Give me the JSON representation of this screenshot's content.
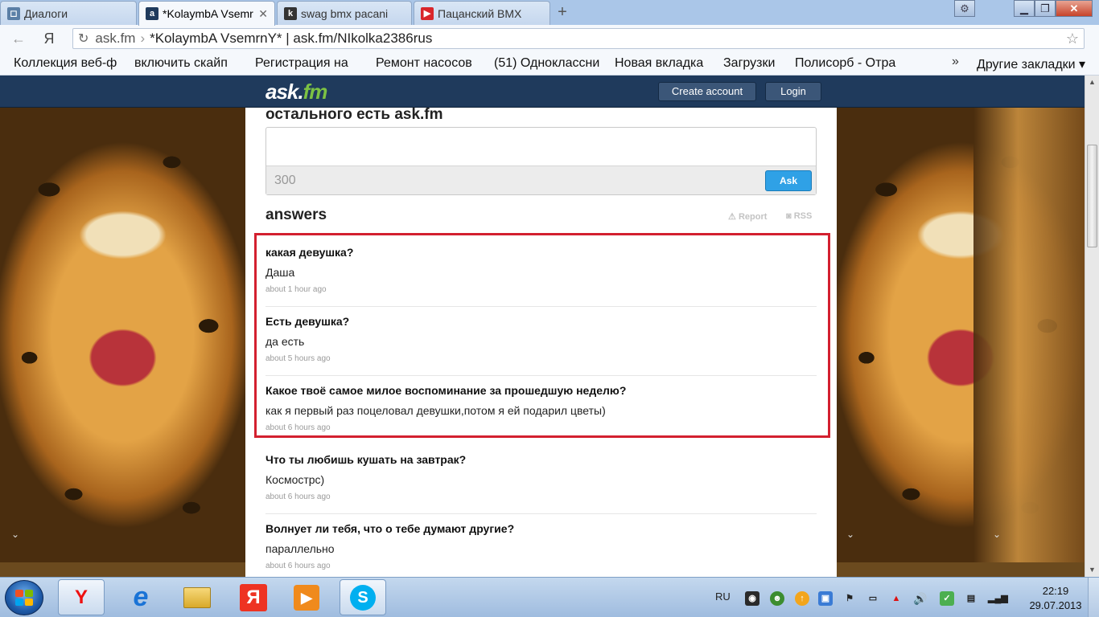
{
  "browser": {
    "tabs": [
      {
        "label": "Диалоги",
        "favicon": "vk-icon"
      },
      {
        "label": "*KolaymbA Vsemr",
        "favicon": "askfm-icon",
        "active": true
      },
      {
        "label": "swag bmx pacani",
        "favicon": "bmx-icon"
      },
      {
        "label": "Пацанский BMX",
        "favicon": "youtube-icon"
      }
    ],
    "new_tab": "+",
    "address": {
      "host": "ask.fm",
      "separator": "›",
      "title": "*KolaymbA VsemrnY* | ask.fm/NIkolka2386rus"
    },
    "nav": {
      "back": "←",
      "yandex": "Я",
      "reload": "↻",
      "star": "☆"
    },
    "bookmarks": [
      "Коллекция веб-ф",
      "включить скайп",
      "Регистрация на",
      "Ремонт насосов",
      "(51) Одноклассни",
      "Новая вкладка",
      "Загрузки",
      "Полисорб - Отра"
    ],
    "bookmarks_more": "»",
    "other_bookmarks": "Другие закладки"
  },
  "askfm": {
    "logo_main": "ask.",
    "logo_fm": "fm",
    "create_account": "Create account",
    "login": "Login",
    "intro_text": "остального есть ask.fm",
    "counter": "300",
    "ask_button": "Ask",
    "answers_title": "answers",
    "report": "Report",
    "rss": "RSS",
    "answers": [
      {
        "question": "какая девушка?",
        "answer": "Даша",
        "time": "about 1 hour ago"
      },
      {
        "question": "Есть девушка?",
        "answer": "да есть",
        "time": "about 5 hours ago"
      },
      {
        "question": "Какое твоё самое милое воспоминание за прошедшую неделю?",
        "answer": "как я первый раз поцеловал девушки,потом я ей подарил цветы)",
        "time": "about 6 hours ago"
      },
      {
        "question": "Что ты любишь кушать на завтрак?",
        "answer": "Космострс)",
        "time": "about 6 hours ago"
      },
      {
        "question": "Волнует ли тебя, что о тебе думают другие?",
        "answer": "параллельно",
        "time": "about 6 hours ago"
      }
    ]
  },
  "taskbar": {
    "apps": [
      {
        "name": "yandex-browser",
        "label": "Y"
      },
      {
        "name": "internet-explorer",
        "label": "e"
      },
      {
        "name": "file-explorer",
        "label": ""
      },
      {
        "name": "yandex",
        "label": "Я"
      },
      {
        "name": "media-player",
        "label": "▶"
      },
      {
        "name": "skype",
        "label": "S"
      }
    ],
    "language": "RU",
    "time": "22:19",
    "date": "29.07.2013"
  },
  "colors": {
    "askfm_header": "#1f3a5c",
    "askfm_green": "#7cc243",
    "ask_button": "#2fa1e6",
    "highlight_border": "#d3202f"
  }
}
